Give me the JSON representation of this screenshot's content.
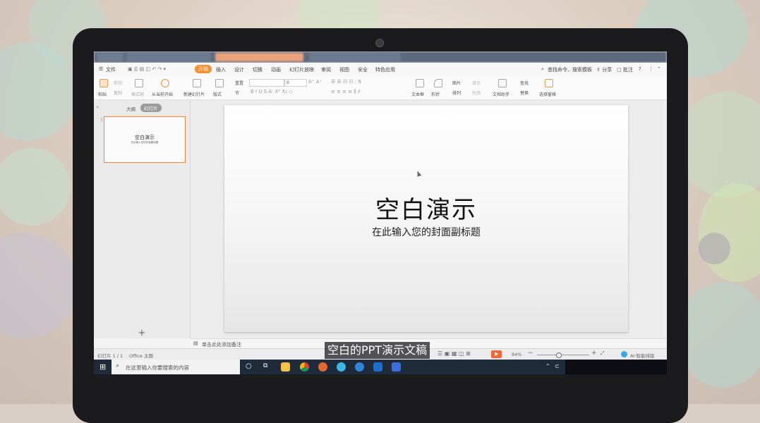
{
  "menubar": {
    "file": "文件",
    "tabs": [
      "开始",
      "插入",
      "设计",
      "切换",
      "动画",
      "幻灯片放映",
      "审阅",
      "视图",
      "安全",
      "特色应用"
    ],
    "search_placeholder": "查找命令、搜索模板",
    "share": "分享",
    "comment": "批注"
  },
  "ribbon": {
    "paste": "粘贴",
    "cut": "剪切",
    "copy": "复制",
    "format_painter": "格式刷",
    "from_current": "从当前开始",
    "new_slide": "新建幻灯片",
    "layout": "版式",
    "section": "节",
    "reset": "重置",
    "font_size": "0",
    "textbox": "文本框",
    "shape": "形状",
    "picture": "图片",
    "arrange": "排列",
    "fill": "填充",
    "outline": "轮廓",
    "doc_assistant": "文档助手",
    "find": "查找",
    "replace": "替换",
    "select_pane": "选择窗格"
  },
  "sidebar": {
    "tab_outline": "大纲",
    "tab_slides": "幻灯片",
    "slide_number": "1",
    "thumb_title": "空白演示",
    "thumb_sub": "在此输入您的封面副标题",
    "add": "+"
  },
  "slide": {
    "title": "空白演示",
    "subtitle": "在此输入您的封面副标题"
  },
  "notes": {
    "placeholder": "单击此处添加备注"
  },
  "status": {
    "slide_count": "幻灯片 1 / 1",
    "theme": "Office 主题",
    "zoom": "84%",
    "ai_layout": "AI·智能排版"
  },
  "taskbar": {
    "search_placeholder": "在这里输入你要搜索的内容"
  },
  "caption": "空白的PPT演示文稿",
  "colors": {
    "accent": "#f58f36",
    "taskbar": "#1f2a3a",
    "play": "#f0683a"
  }
}
